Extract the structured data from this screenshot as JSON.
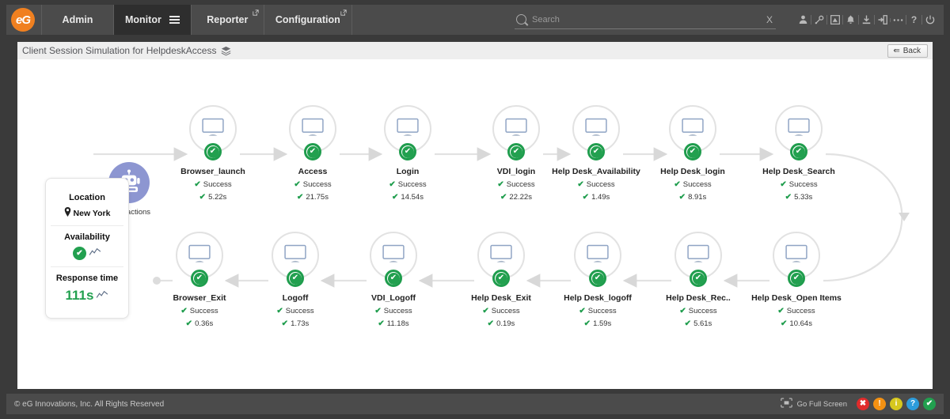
{
  "app": {
    "logo_text": "eG",
    "brand_orange": "#f08020",
    "success_green": "#22a04f"
  },
  "topnav": {
    "tabs": [
      {
        "label": "Admin",
        "active": false,
        "external": false,
        "menu": false
      },
      {
        "label": "Monitor",
        "active": true,
        "external": false,
        "menu": true
      },
      {
        "label": "Reporter",
        "active": false,
        "external": true,
        "menu": false
      },
      {
        "label": "Configuration",
        "active": false,
        "external": true,
        "menu": false
      }
    ],
    "search": {
      "value": "",
      "placeholder": "Search",
      "clear_label": "X"
    },
    "icons": [
      {
        "name": "user-icon",
        "glyph": "♟"
      },
      {
        "name": "link-icon",
        "glyph": "✂"
      },
      {
        "name": "dashboard-icon",
        "glyph": "▣"
      },
      {
        "name": "bell-icon",
        "glyph": "🔔"
      },
      {
        "name": "download-icon",
        "glyph": "⤓"
      },
      {
        "name": "login-icon",
        "glyph": "⇥"
      },
      {
        "name": "more-icon",
        "glyph": "⋯"
      },
      {
        "name": "help-icon",
        "glyph": "?"
      },
      {
        "name": "power-icon",
        "glyph": "⏻"
      }
    ]
  },
  "titlebar": {
    "title": "Client Session Simulation for HelpdeskAccess",
    "back_label": "Back"
  },
  "start_node": {
    "label": "Transactions",
    "icon": "robot-icon"
  },
  "info_card": {
    "location": {
      "heading": "Location",
      "value": "New York"
    },
    "availability": {
      "heading": "Availability",
      "status": "ok"
    },
    "response_time": {
      "heading": "Response time",
      "value": "111s"
    }
  },
  "flow": {
    "status_label": "Success",
    "row1": [
      {
        "name": "Browser_launch",
        "status": "Success",
        "time": "5.22s"
      },
      {
        "name": "Access",
        "status": "Success",
        "time": "21.75s"
      },
      {
        "name": "Login",
        "status": "Success",
        "time": "14.54s"
      },
      {
        "name": "VDI_login",
        "status": "Success",
        "time": "22.22s"
      },
      {
        "name": "Help Desk_Availability",
        "status": "Success",
        "time": "1.49s"
      },
      {
        "name": "Help Desk_login",
        "status": "Success",
        "time": "8.91s"
      },
      {
        "name": "Help Desk_Search",
        "status": "Success",
        "time": "5.33s"
      }
    ],
    "row2": [
      {
        "name": "Browser_Exit",
        "status": "Success",
        "time": "0.36s"
      },
      {
        "name": "Logoff",
        "status": "Success",
        "time": "1.73s"
      },
      {
        "name": "VDI_Logoff",
        "status": "Success",
        "time": "11.18s"
      },
      {
        "name": "Help Desk_Exit",
        "status": "Success",
        "time": "0.19s"
      },
      {
        "name": "Help Desk_logoff",
        "status": "Success",
        "time": "1.59s"
      },
      {
        "name": "Help Desk_Rec..",
        "status": "Success",
        "time": "5.61s"
      },
      {
        "name": "Help Desk_Open Items",
        "status": "Success",
        "time": "10.64s"
      }
    ]
  },
  "footer": {
    "copyright": "© eG Innovations, Inc. All Rights Reserved",
    "fullscreen_label": "Go Full Screen",
    "severities": [
      {
        "name": "critical",
        "glyph": "✖",
        "color": "#e02b2b"
      },
      {
        "name": "major",
        "glyph": "!",
        "color": "#f49112"
      },
      {
        "name": "minor",
        "glyph": "i",
        "color": "#d6c71e"
      },
      {
        "name": "unknown",
        "glyph": "?",
        "color": "#2d9cdb"
      },
      {
        "name": "normal",
        "glyph": "✔",
        "color": "#22a04f"
      }
    ]
  }
}
